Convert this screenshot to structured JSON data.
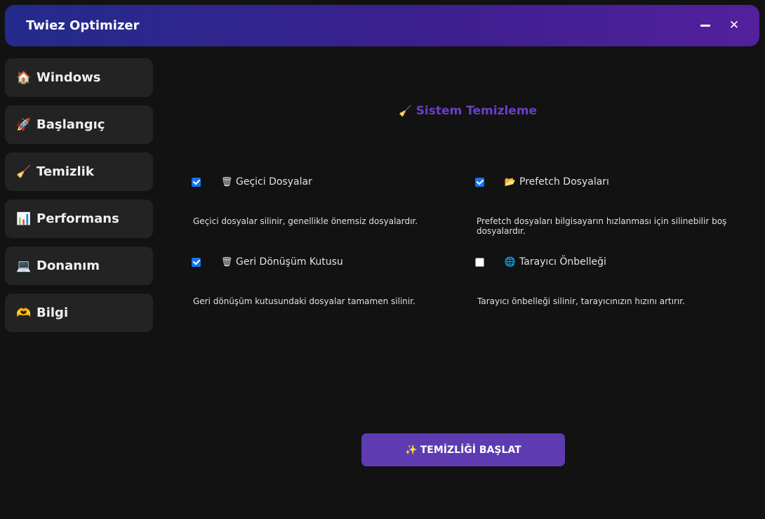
{
  "app": {
    "title": "Twiez Optimizer",
    "close_glyph": "✕"
  },
  "colors": {
    "titlebar_gradient_start": "#232b8c",
    "titlebar_gradient_end": "#53209c",
    "accent": "#6a3fc4",
    "button": "#5e3bb1",
    "checkbox": "#1a73e8",
    "background": "#121212",
    "nav_item": "#232323"
  },
  "sidebar": {
    "items": [
      {
        "icon": "🏠",
        "icon_name": "house-icon",
        "label": "Windows"
      },
      {
        "icon": "🚀",
        "icon_name": "rocket-icon",
        "label": "Başlangıç"
      },
      {
        "icon": "🧹",
        "icon_name": "broom-icon",
        "label": "Temizlik"
      },
      {
        "icon": "📊",
        "icon_name": "chart-icon",
        "label": "Performans"
      },
      {
        "icon": "💻",
        "icon_name": "laptop-icon",
        "label": "Donanım"
      },
      {
        "icon": "🫶",
        "icon_name": "heart-hands-icon",
        "label": "Bilgi"
      }
    ]
  },
  "main": {
    "section_icon": "🧹",
    "section_title": "Sistem Temizleme",
    "options": [
      {
        "icon": "🗑",
        "icon_name": "trash-icon",
        "label": "Geçici Dosyalar",
        "checked": true,
        "description": "Geçici dosyalar silinir, genellikle önemsiz dosyalardır."
      },
      {
        "icon": "📂",
        "icon_name": "folder-icon",
        "label": "Prefetch Dosyaları",
        "checked": true,
        "description": "Prefetch dosyaları bilgisayarın hızlanması için silinebilir boş dosyalardır."
      },
      {
        "icon": "🗑",
        "icon_name": "recycle-bin-icon",
        "label": "Geri Dönüşüm Kutusu",
        "checked": true,
        "description": "Geri dönüşüm kutusundaki dosyalar tamamen silinir."
      },
      {
        "icon": "🌐",
        "icon_name": "globe-icon",
        "label": "Tarayıcı Önbelleği",
        "checked": false,
        "description": "Tarayıcı önbelleği silinir, tarayıcınızın hızını artırır."
      }
    ],
    "start_button_icon": "✨",
    "start_button_label": "TEMİZLİĞİ BAŞLAT"
  }
}
